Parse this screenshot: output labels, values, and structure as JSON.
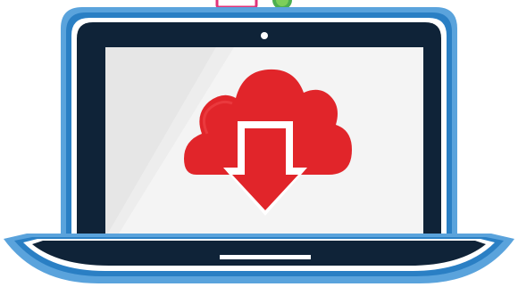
{
  "illustration": {
    "subject": "laptop-cloud-download-illustration",
    "colors": {
      "laptop_frame_outer": "#5aa3dc",
      "laptop_frame_mid": "#2a7fc4",
      "laptop_bezel": "#0f2338",
      "screen_background": "#f4f4f4",
      "screen_glare": "#e6e6e6",
      "cloud": "#e1252a",
      "cloud_highlight": "#f0474b",
      "arrow_outline": "#ffffff",
      "base_plate": "#0f2338",
      "base_groove": "#ffffff",
      "peek_pink": "#e0337a",
      "peek_green": "#4caf50"
    },
    "icons": [
      "laptop-icon",
      "cloud-icon",
      "download-arrow-icon",
      "camera-dot-icon"
    ]
  }
}
